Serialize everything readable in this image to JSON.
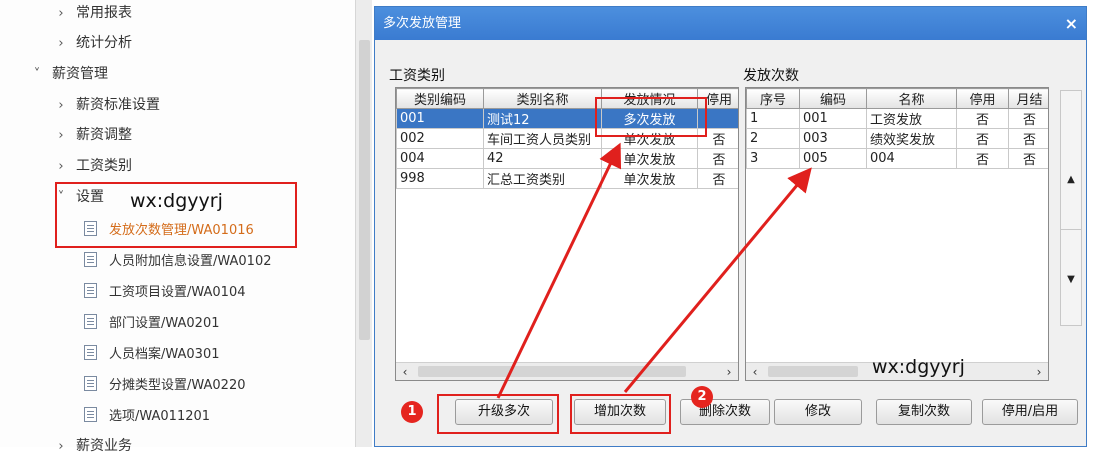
{
  "nav": {
    "items": [
      {
        "type": "branch",
        "label": "常用报表"
      },
      {
        "type": "branch",
        "label": "统计分析"
      },
      {
        "type": "group-open",
        "label": "薪资管理"
      },
      {
        "type": "branch",
        "label": "薪资标准设置"
      },
      {
        "type": "branch",
        "label": "薪资调整"
      },
      {
        "type": "branch",
        "label": "工资类别"
      },
      {
        "type": "group-open",
        "label": "设置"
      },
      {
        "type": "leaf",
        "label": "发放次数管理/WA01016"
      },
      {
        "type": "leaf",
        "label": "人员附加信息设置/WA0102"
      },
      {
        "type": "leaf",
        "label": "工资项目设置/WA0104"
      },
      {
        "type": "leaf",
        "label": "部门设置/WA0201"
      },
      {
        "type": "leaf",
        "label": "人员档案/WA0301"
      },
      {
        "type": "leaf",
        "label": "分摊类型设置/WA0220"
      },
      {
        "type": "leaf",
        "label": "选项/WA011201"
      },
      {
        "type": "branch",
        "label": "薪资业务"
      }
    ]
  },
  "dialog": {
    "title": "多次发放管理",
    "close_glyph": "×"
  },
  "left_grid": {
    "label": "工资类别",
    "columns": [
      "类别编码",
      "类别名称",
      "发放情况",
      "停用"
    ],
    "rows": [
      [
        "001",
        "测试12",
        "多次发放",
        ""
      ],
      [
        "002",
        "车间工资人员类别",
        "单次发放",
        "否"
      ],
      [
        "004",
        "42",
        "单次发放",
        "否"
      ],
      [
        "998",
        "汇总工资类别",
        "单次发放",
        "否"
      ]
    ],
    "selected_row": 0
  },
  "right_grid": {
    "label": "发放次数",
    "columns": [
      "序号",
      "编码",
      "名称",
      "停用",
      "月结"
    ],
    "rows": [
      [
        "1",
        "001",
        "工资发放",
        "否",
        "否"
      ],
      [
        "2",
        "003",
        "绩效奖发放",
        "否",
        "否"
      ],
      [
        "3",
        "005",
        "004",
        "否",
        "否"
      ]
    ]
  },
  "buttons": {
    "upgrade": "升级多次",
    "add": "增加次数",
    "delete": "删除次数",
    "modify": "修改",
    "copy": "复制次数",
    "toggle": "停用/启用"
  },
  "annotations": {
    "watermark": "wx:dgyyrj",
    "badge_1": "1",
    "badge_2": "2"
  },
  "colors": {
    "title_bar": "#3a7bd1",
    "selection": "#3a76c4",
    "annotation_red": "#e0201d",
    "active_leaf_text": "#d46c1a"
  }
}
